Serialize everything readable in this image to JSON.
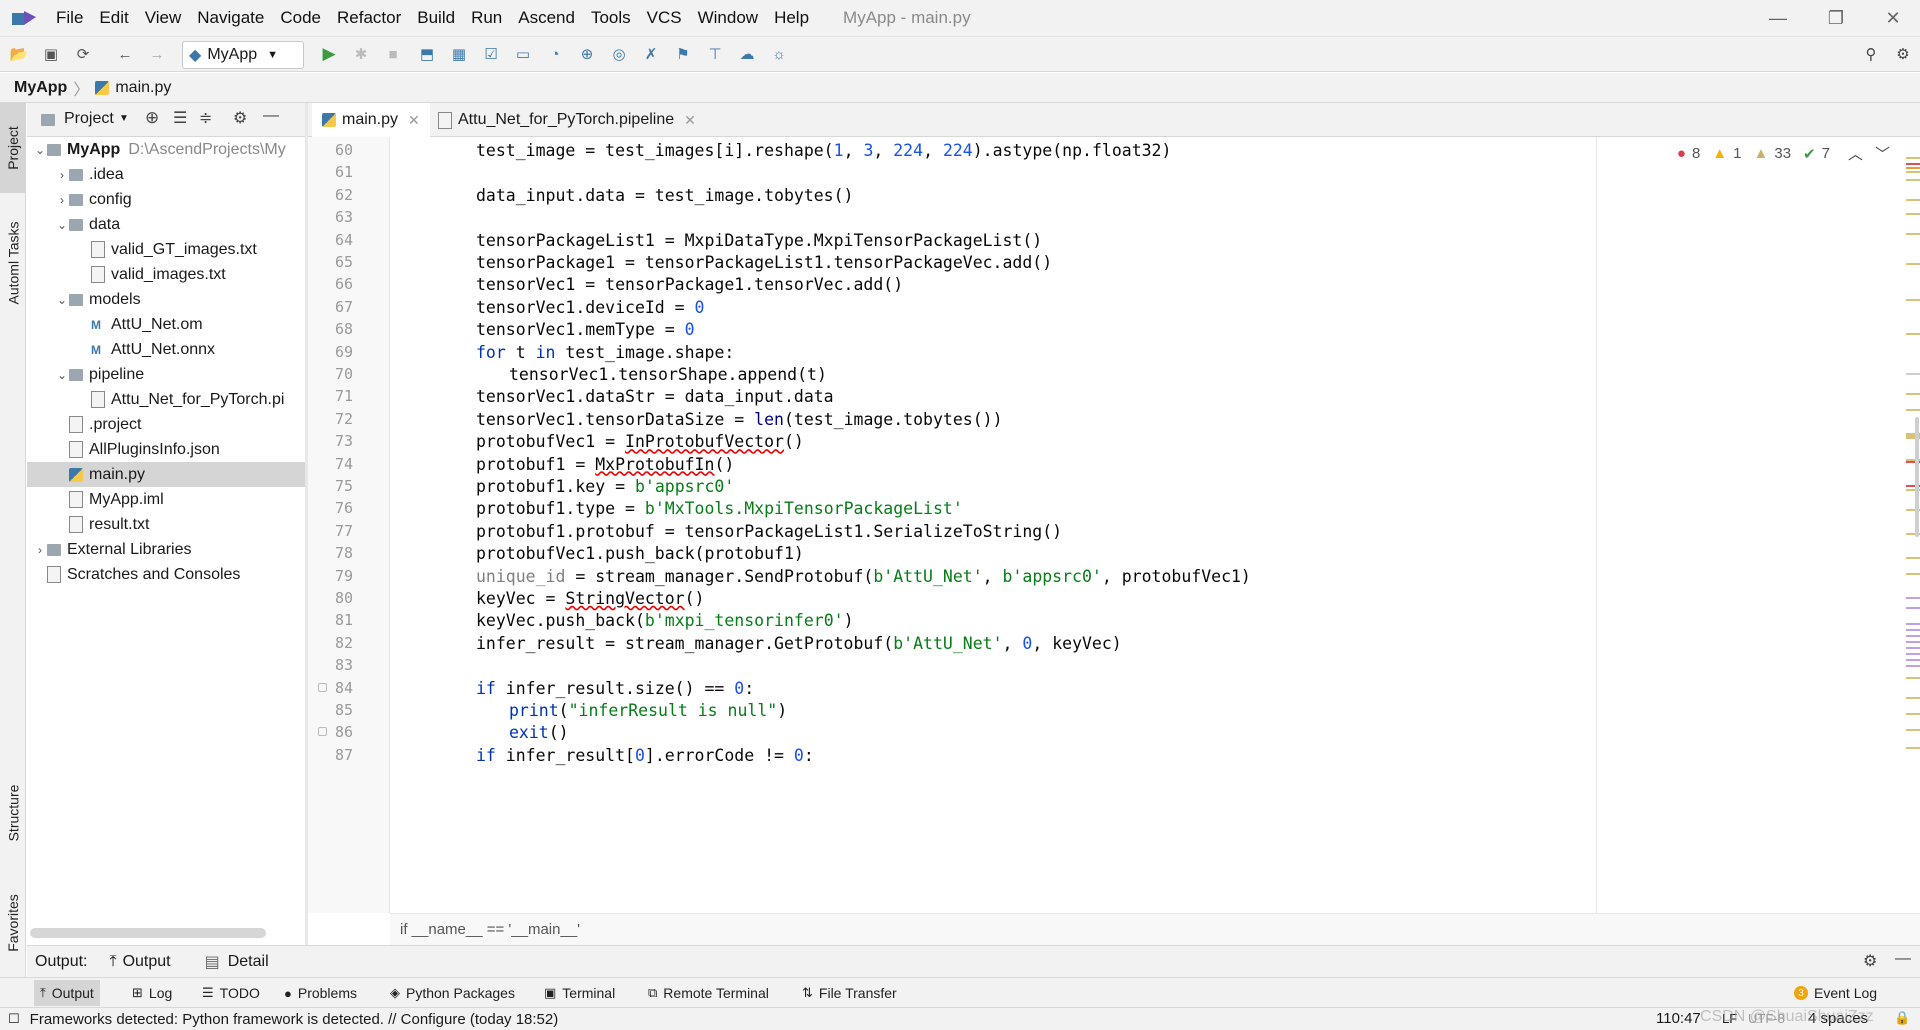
{
  "menubar": {
    "items": [
      "File",
      "Edit",
      "View",
      "Navigate",
      "Code",
      "Refactor",
      "Build",
      "Run",
      "Ascend",
      "Tools",
      "VCS",
      "Window",
      "Help"
    ],
    "title": "MyApp - main.py"
  },
  "toolbar": {
    "run_config": "MyApp"
  },
  "breadcrumb": {
    "project": "MyApp",
    "file": "main.py"
  },
  "left_stripe": {
    "tabs": [
      "Project",
      "Automl Tasks",
      "Structure",
      "Favorites"
    ]
  },
  "project_panel": {
    "header": "Project",
    "tree": [
      {
        "label": "MyApp",
        "extra": "D:\\AscendProjects\\My",
        "depth": 0,
        "type": "root",
        "expanded": true
      },
      {
        "label": ".idea",
        "depth": 1,
        "type": "folder",
        "expanded": false
      },
      {
        "label": "config",
        "depth": 1,
        "type": "folder",
        "expanded": false
      },
      {
        "label": "data",
        "depth": 1,
        "type": "folder",
        "expanded": true
      },
      {
        "label": "valid_GT_images.txt",
        "depth": 2,
        "type": "file"
      },
      {
        "label": "valid_images.txt",
        "depth": 2,
        "type": "file"
      },
      {
        "label": "models",
        "depth": 1,
        "type": "folder",
        "expanded": true
      },
      {
        "label": "AttU_Net.om",
        "depth": 2,
        "type": "model"
      },
      {
        "label": "AttU_Net.onnx",
        "depth": 2,
        "type": "model"
      },
      {
        "label": "pipeline",
        "depth": 1,
        "type": "folder",
        "expanded": true
      },
      {
        "label": "Attu_Net_for_PyTorch.pi",
        "depth": 2,
        "type": "file"
      },
      {
        "label": ".project",
        "depth": 1,
        "type": "file"
      },
      {
        "label": "AllPluginsInfo.json",
        "depth": 1,
        "type": "file"
      },
      {
        "label": "main.py",
        "depth": 1,
        "type": "py",
        "selected": true
      },
      {
        "label": "MyApp.iml",
        "depth": 1,
        "type": "file"
      },
      {
        "label": "result.txt",
        "depth": 1,
        "type": "file"
      },
      {
        "label": "External Libraries",
        "depth": 0,
        "type": "lib",
        "expanded": false
      },
      {
        "label": "Scratches and Consoles",
        "depth": 0,
        "type": "scratch"
      }
    ]
  },
  "editor_tabs": [
    {
      "label": "main.py",
      "active": true
    },
    {
      "label": "Attu_Net_for_PyTorch.pipeline",
      "active": false
    }
  ],
  "inspections": {
    "errors": "8",
    "warnings": "1",
    "weak_warnings": "33",
    "ok": "7"
  },
  "code_lines": [
    {
      "n": "60",
      "indent": 0,
      "text": "test_image = test_images[i].reshape(1, 3, 224, 224).astype(np.float32)"
    },
    {
      "n": "61",
      "indent": 0,
      "text": ""
    },
    {
      "n": "62",
      "indent": 0,
      "text": "data_input.data = test_image.tobytes()"
    },
    {
      "n": "63",
      "indent": 0,
      "text": ""
    },
    {
      "n": "64",
      "indent": 0,
      "text": "tensorPackageList1 = MxpiDataType.MxpiTensorPackageList()"
    },
    {
      "n": "65",
      "indent": 0,
      "text": "tensorPackage1 = tensorPackageList1.tensorPackageVec.add()"
    },
    {
      "n": "66",
      "indent": 0,
      "text": "tensorVec1 = tensorPackage1.tensorVec.add()"
    },
    {
      "n": "67",
      "indent": 0,
      "text": "tensorVec1.deviceId = 0"
    },
    {
      "n": "68",
      "indent": 0,
      "text": "tensorVec1.memType = 0"
    },
    {
      "n": "69",
      "indent": 0,
      "text": "for t in test_image.shape:"
    },
    {
      "n": "70",
      "indent": 1,
      "text": "tensorVec1.tensorShape.append(t)"
    },
    {
      "n": "71",
      "indent": 0,
      "text": "tensorVec1.dataStr = data_input.data"
    },
    {
      "n": "72",
      "indent": 0,
      "text": "tensorVec1.tensorDataSize = len(test_image.tobytes())"
    },
    {
      "n": "73",
      "indent": 0,
      "text": "protobufVec1 = InProtobufVector()"
    },
    {
      "n": "74",
      "indent": 0,
      "text": "protobuf1 = MxProtobufIn()"
    },
    {
      "n": "75",
      "indent": 0,
      "text": "protobuf1.key = b'appsrc0'"
    },
    {
      "n": "76",
      "indent": 0,
      "text": "protobuf1.type = b'MxTools.MxpiTensorPackageList'"
    },
    {
      "n": "77",
      "indent": 0,
      "text": "protobuf1.protobuf = tensorPackageList1.SerializeToString()"
    },
    {
      "n": "78",
      "indent": 0,
      "text": "protobufVec1.push_back(protobuf1)"
    },
    {
      "n": "79",
      "indent": 0,
      "text": "unique_id = stream_manager.SendProtobuf(b'AttU_Net', b'appsrc0', protobufVec1)"
    },
    {
      "n": "80",
      "indent": 0,
      "text": "keyVec = StringVector()"
    },
    {
      "n": "81",
      "indent": 0,
      "text": "keyVec.push_back(b'mxpi_tensorinfer0')"
    },
    {
      "n": "82",
      "indent": 0,
      "text": "infer_result = stream_manager.GetProtobuf(b'AttU_Net', 0, keyVec)"
    },
    {
      "n": "83",
      "indent": 0,
      "text": ""
    },
    {
      "n": "84",
      "indent": 0,
      "text": "if infer_result.size() == 0:"
    },
    {
      "n": "85",
      "indent": 1,
      "text": "print(\"inferResult is null\")"
    },
    {
      "n": "86",
      "indent": 1,
      "text": "exit()"
    },
    {
      "n": "87",
      "indent": 0,
      "text": "if infer_result[0].errorCode != 0:"
    }
  ],
  "scope_bar": "if __name__ == '__main__'",
  "output_panel": {
    "label": "Output:",
    "tabs": [
      "Output",
      "Detail"
    ]
  },
  "bottom_tabs": [
    "Output",
    "Log",
    "TODO",
    "Problems",
    "Python Packages",
    "Terminal",
    "Remote Terminal",
    "File Transfer"
  ],
  "event_log": {
    "label": "Event Log",
    "count": "3"
  },
  "status": {
    "message": "Frameworks detected: Python framework is detected. // Configure (today 18:52)",
    "position": "110:47",
    "line_sep": "LF",
    "encoding": "UTF-8",
    "indent": "4 spaces",
    "watermark": "CSDN @ShuaiShuaiZzz"
  },
  "colors": {
    "accent": "#4083c9",
    "selection": "#d5d5d5",
    "error": "#db3b4b",
    "warning": "#f2b10e",
    "ok": "#3f9b3f",
    "keyword": "#0033b3",
    "string": "#067d17",
    "number": "#1750eb"
  }
}
